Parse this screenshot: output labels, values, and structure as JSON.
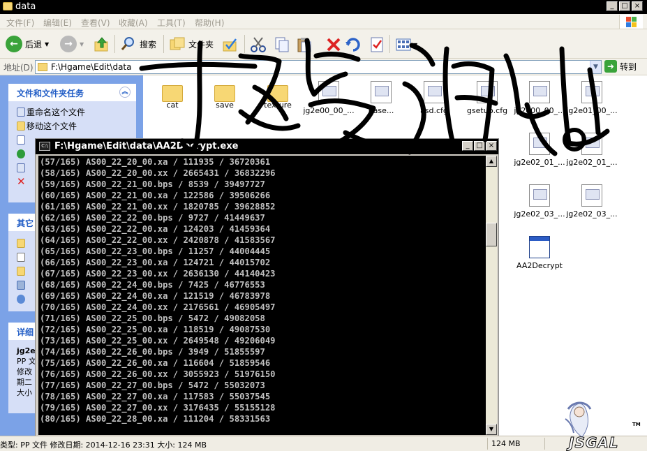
{
  "window": {
    "title": "data",
    "controls": [
      "_",
      "□",
      "×"
    ]
  },
  "menubar": [
    "文件(F)",
    "编辑(E)",
    "查看(V)",
    "收藏(A)",
    "工具(T)",
    "帮助(H)"
  ],
  "toolbar": {
    "back_label": "后退",
    "search_label": "搜索",
    "folders_label": "文件夹"
  },
  "address": {
    "label": "地址(D)",
    "path": "F:\\Hgame\\Edit\\data",
    "go_label": "转到"
  },
  "tasks_panel": {
    "title": "文件和文件夹任务",
    "items": [
      "重命名这个文件",
      "移动这个文件"
    ]
  },
  "other_panel": {
    "title": "其它"
  },
  "details_panel": {
    "title": "详细",
    "name": "jg2e",
    "lines": [
      "PP 文",
      "修改",
      "期二",
      "大小"
    ]
  },
  "files": [
    {
      "name": "cat",
      "kind": "folder"
    },
    {
      "name": "save",
      "kind": "folder"
    },
    {
      "name": "texture",
      "kind": "folder"
    },
    {
      "name": "jg2e00_00_...",
      "kind": "file"
    },
    {
      "name": "base...",
      "kind": "file"
    },
    {
      "name": "asd.cfg",
      "kind": "file"
    },
    {
      "name": "gsetup.cfg",
      "kind": "file"
    },
    {
      "name": "jg2e00_00_...",
      "kind": "file"
    },
    {
      "name": "jg2e01_00_...",
      "kind": "file"
    },
    {
      "name": "jg2e02_01_...",
      "kind": "file"
    },
    {
      "name": "jg2e02_01_...",
      "kind": "file"
    },
    {
      "name": "jg2e02_03_...",
      "kind": "file"
    },
    {
      "name": "jg2e02_03_...",
      "kind": "file"
    },
    {
      "name": "AA2Decrypt",
      "kind": "app"
    }
  ],
  "console": {
    "title": "F:\\Hgame\\Edit\\data\\AA2Decrypt.exe",
    "lines": [
      "(57/165) AS00_22_20_00.xa / 111935 / 36720361",
      "(58/165) AS00_22_20_00.xx / 2665431 / 36832296",
      "(59/165) AS00_22_21_00.bps / 8539 / 39497727",
      "(60/165) AS00_22_21_00.xa / 122586 / 39506266",
      "(61/165) AS00_22_21_00.xx / 1820785 / 39628852",
      "(62/165) AS00_22_22_00.bps / 9727 / 41449637",
      "(63/165) AS00_22_22_00.xa / 124203 / 41459364",
      "(64/165) AS00_22_22_00.xx / 2420878 / 41583567",
      "(65/165) AS00_22_23_00.bps / 11257 / 44004445",
      "(66/165) AS00_22_23_00.xa / 124721 / 44015702",
      "(67/165) AS00_22_23_00.xx / 2636130 / 44140423",
      "(68/165) AS00_22_24_00.bps / 7425 / 46776553",
      "(69/165) AS00_22_24_00.xa / 121519 / 46783978",
      "(70/165) AS00_22_24_00.xx / 2176561 / 46905497",
      "(71/165) AS00_22_25_00.bps / 5472 / 49082058",
      "(72/165) AS00_22_25_00.xa / 118519 / 49087530",
      "(73/165) AS00_22_25_00.xx / 2649548 / 49206049",
      "(74/165) AS00_22_26_00.bps / 3949 / 51855597",
      "(75/165) AS00_22_26_00.xa / 116604 / 51859546",
      "(76/165) AS00_22_26_00.xx / 3055923 / 51976150",
      "(77/165) AS00_22_27_00.bps / 5472 / 55032073",
      "(78/165) AS00_22_27_00.xa / 117583 / 55037545",
      "(79/165) AS00_22_27_00.xx / 3176435 / 55155128",
      "(80/165) AS00_22_28_00.xa / 111204 / 58331563"
    ]
  },
  "statusbar": {
    "info": "类型: PP 文件 修改日期: 2014-12-16 23:31 大小: 124 MB",
    "size": "124 MB"
  },
  "watermark": {
    "brand": "JSGAL",
    "tm": "TM"
  },
  "colors": {
    "xp_blue": "#215dc6",
    "taskpane": "#7ba2e7",
    "console_bg": "#000000",
    "console_fg": "#c0c0c0"
  }
}
